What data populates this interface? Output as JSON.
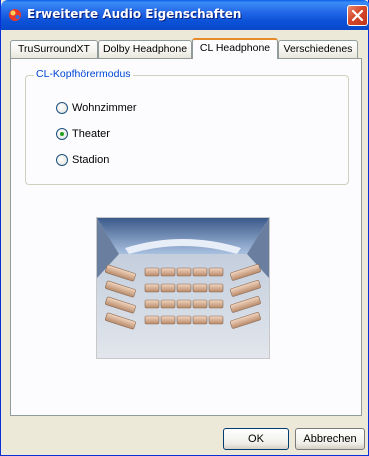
{
  "window": {
    "title": "Erweiterte Audio Eigenschaften"
  },
  "tabs": [
    {
      "label": "TruSurroundXT",
      "active": false
    },
    {
      "label": "Dolby Headphone",
      "active": false
    },
    {
      "label": "CL Headphone",
      "active": true
    },
    {
      "label": "Verschiedenes",
      "active": false
    }
  ],
  "group": {
    "label": "CL-Kopfhörermodus",
    "options": [
      {
        "label": "Wohnzimmer",
        "selected": false
      },
      {
        "label": "Theater",
        "selected": true
      },
      {
        "label": "Stadion",
        "selected": false
      }
    ]
  },
  "preview": {
    "icon": "theater-seating-image"
  },
  "buttons": {
    "ok": "OK",
    "cancel": "Abbrechen"
  },
  "colors": {
    "titlebar": "#0a52d8",
    "close": "#d5482a",
    "accent_tab": "#e68b2c",
    "group_label": "#0046d5",
    "radio_dot": "#21a121"
  }
}
